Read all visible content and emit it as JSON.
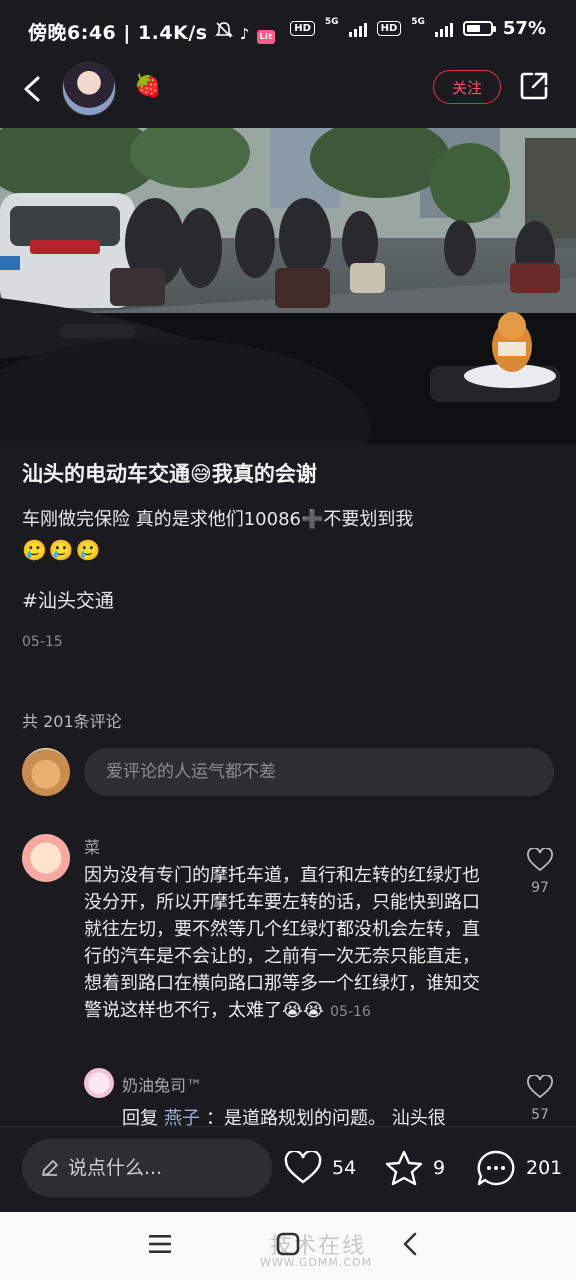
{
  "status_bar": {
    "time": "傍晚6:46",
    "speed": "1.4K/s",
    "net1": "5G",
    "net2": "5G",
    "hd1": "HD",
    "hd2": "HD",
    "battery_percent": "57%",
    "battery_level": 0.57,
    "icons": [
      "mute-icon",
      "tiktok-icon",
      "app-badge-icon"
    ]
  },
  "header": {
    "follow_label": "关注",
    "badge_emoji": "🍓"
  },
  "post": {
    "title": "汕头的电动车交通😅我真的会谢",
    "body": "车刚做完保险 真的是求他们10086➕不要划到我",
    "emojis": "🥲🥲🥲",
    "hashtag": "#汕头交通",
    "date": "05-15"
  },
  "comments_section": {
    "count_label": "共 201条评论",
    "input_placeholder": "爱评论的人运气都不差"
  },
  "comments": [
    {
      "user": "菜",
      "text": "因为没有专门的摩托车道，直行和左转的红绿灯也没分开，所以开摩托车要左转的话，只能快到路口就往左切，要不然等几个红绿灯都没机会左转，直行的汽车是不会让的，之前有一次无奈只能直走，想着到路口在横向路口那等多一个红绿灯，谁知交警说这样也不行，太难了😭😭",
      "date": "05-16",
      "likes": "97"
    }
  ],
  "reply": {
    "user": "奶油兔司™",
    "prefix": "回复",
    "mention": "燕子",
    "text": "：是道路规划的问题。 汕头很",
    "likes": "57"
  },
  "action_bar": {
    "input_placeholder": "说点什么...",
    "likes": "54",
    "stars": "9",
    "comments": "201"
  },
  "watermark": {
    "text": "技术在线",
    "url": "WWW.GDMM.COM"
  },
  "colors": {
    "background": "#1b1b1f",
    "accent": "#ff4d6a",
    "muted": "#8c8c90"
  }
}
